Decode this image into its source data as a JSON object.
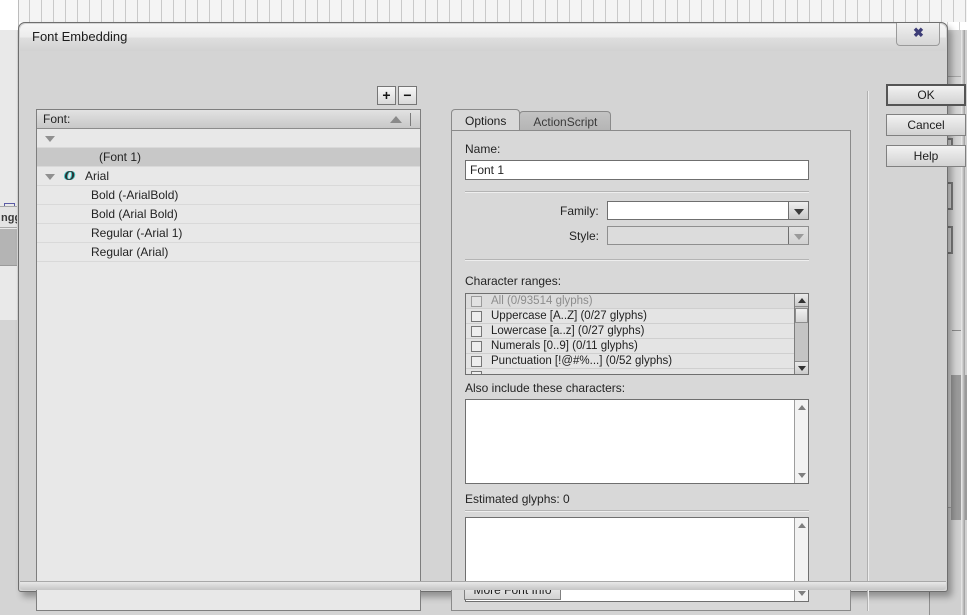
{
  "dialog": {
    "title": "Font Embedding",
    "close_icon": "close-x-icon",
    "close_label": "✖"
  },
  "font_list": {
    "add_label": "+",
    "remove_label": "−",
    "header": "Font:",
    "rows": [
      {
        "label": "",
        "indent": 0,
        "type": "group-toggle",
        "selected": false,
        "has_triangle": true
      },
      {
        "label": "(Font 1)",
        "indent": 62,
        "type": "font-entry",
        "selected": true,
        "has_triangle": false
      },
      {
        "label": "Arial",
        "indent": 48,
        "type": "font-family",
        "selected": false,
        "has_triangle": true,
        "has_otf_icon": true
      },
      {
        "label": "Bold (-ArialBold)",
        "indent": 54,
        "type": "font-style",
        "selected": false,
        "has_triangle": false
      },
      {
        "label": "Bold (Arial Bold)",
        "indent": 54,
        "type": "font-style",
        "selected": false,
        "has_triangle": false
      },
      {
        "label": "Regular (-Arial 1)",
        "indent": 54,
        "type": "font-style",
        "selected": false,
        "has_triangle": false
      },
      {
        "label": "Regular (Arial)",
        "indent": 54,
        "type": "font-style",
        "selected": false,
        "has_triangle": false
      }
    ]
  },
  "tabs": [
    {
      "label": "Options",
      "active": true
    },
    {
      "label": "ActionScript",
      "active": false
    }
  ],
  "options": {
    "name_label": "Name:",
    "name_value": "Font 1",
    "name_placeholder": "",
    "family_label": "Family:",
    "family_value": "",
    "family_placeholder": "",
    "style_label": "Style:",
    "style_value": "",
    "style_placeholder": "",
    "character_ranges_label": "Character ranges:",
    "character_ranges": [
      {
        "label": "All  (0/93514 glyphs)",
        "checked": false,
        "disabled": true
      },
      {
        "label": "Uppercase [A..Z]  (0/27 glyphs)",
        "checked": false,
        "disabled": false
      },
      {
        "label": "Lowercase [a..z]  (0/27 glyphs)",
        "checked": false,
        "disabled": false
      },
      {
        "label": "Numerals [0..9]  (0/11 glyphs)",
        "checked": false,
        "disabled": false
      },
      {
        "label": "Punctuation [!@#%...]  (0/52 glyphs)",
        "checked": false,
        "disabled": false
      },
      {
        "label": "",
        "checked": false,
        "disabled": false
      }
    ],
    "also_include_label": "Also include these characters:",
    "also_include_value": "",
    "estimated_glyphs_label": "Estimated glyphs: 0",
    "preview_value": "",
    "more_font_info_label": "More Font Info"
  },
  "buttons": {
    "ok": "OK",
    "cancel": "Cancel",
    "help": "Help"
  },
  "background": {
    "left_tab_label": "ngg"
  }
}
